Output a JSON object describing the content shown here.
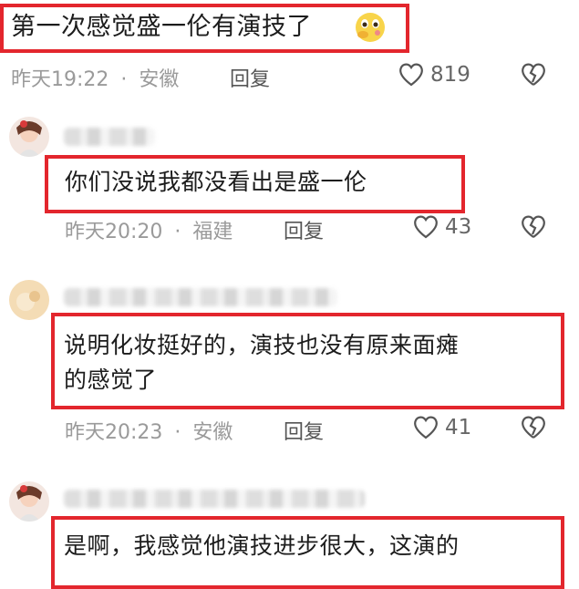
{
  "comments": [
    {
      "text": "第一次感觉盛一伦有演技了",
      "emoji": "thinking-face-emoji",
      "time": "昨天19:22",
      "location": "安徽",
      "reply": "回复",
      "likes": "819"
    },
    {
      "text": "你们没说我都没看出是盛一伦",
      "time": "昨天20:20",
      "location": "福建",
      "reply": "回复",
      "likes": "43"
    },
    {
      "text_line1": "说明化妆挺好的，演技也没有原来面瘫",
      "text_line2": "的感觉了",
      "time": "昨天20:23",
      "location": "安徽",
      "reply": "回复",
      "likes": "41"
    },
    {
      "text": "是啊，我感觉他演技进步很大，这演的"
    }
  ],
  "separator": "·",
  "colors": {
    "highlight": "#e3262d",
    "meta": "#9a9a9a"
  }
}
